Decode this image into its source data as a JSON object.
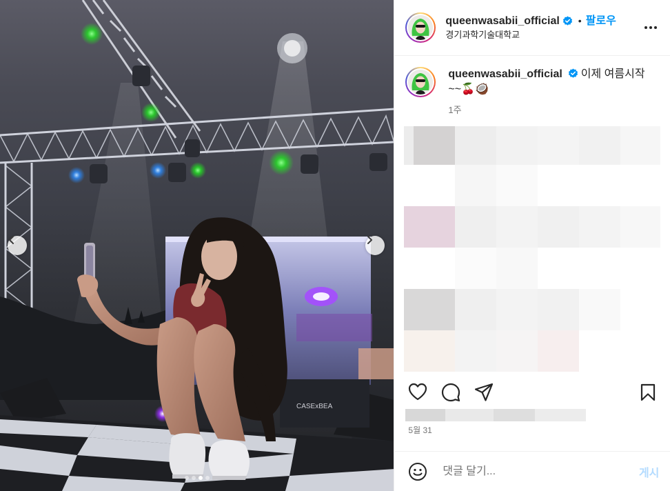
{
  "post": {
    "author": {
      "username": "queenwasabii_official",
      "verified": true,
      "follow_label": "팔로우",
      "location": "경기과학기술대학교"
    },
    "caption": {
      "username": "queenwasabii_official",
      "text": "이제 여름시작~~🍒🥥",
      "time": "1주"
    },
    "date": "5월 31",
    "comment": {
      "placeholder": "댓글 달기...",
      "post_label": "게시"
    },
    "media": {
      "carousel_total": 4,
      "carousel_active": 3
    }
  },
  "icons": {
    "verified": "verified-badge-icon",
    "more": "more-options-icon",
    "like": "heart-icon",
    "comment": "comment-bubble-icon",
    "share": "paper-plane-icon",
    "save": "bookmark-icon",
    "emoji": "smiley-icon",
    "prev": "chevron-left-icon",
    "next": "chevron-right-icon"
  },
  "colors": {
    "accent": "#0095f6",
    "verified": "#0095f6",
    "post_disabled": "#b3dbff",
    "muted": "#737373"
  }
}
